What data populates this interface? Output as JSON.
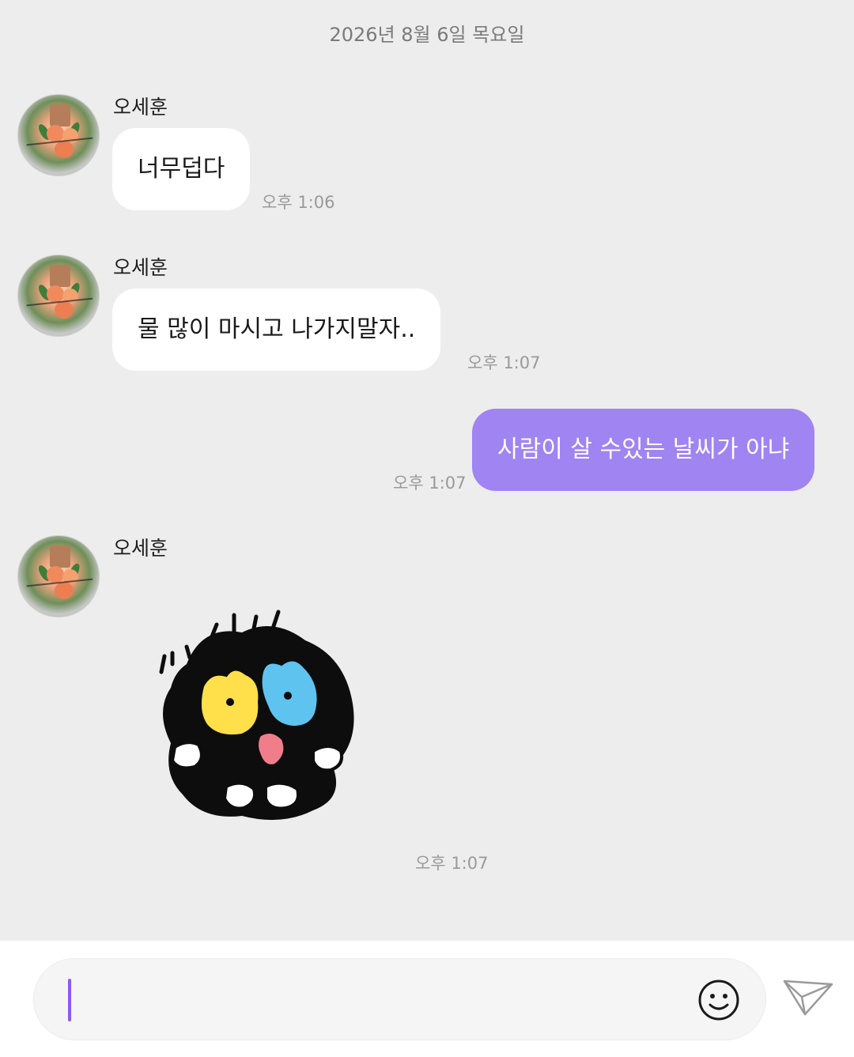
{
  "date_divider": "2026년 8월 6일 목요일",
  "messages": [
    {
      "sender": "오세훈",
      "text": "너무덥다",
      "time": "오후 1:06"
    },
    {
      "sender": "오세훈",
      "text": "물 많이 마시고 나가지말자..",
      "time": "오후 1:07"
    },
    {
      "sender": "me",
      "text": "사람이 살 수있는 날씨가 아냐",
      "time": "오후 1:07"
    },
    {
      "sender": "오세훈",
      "sticker": "screaming-blob-sticker",
      "time": "오후 1:07"
    }
  ],
  "input": {
    "value": "",
    "placeholder": ""
  },
  "icons": {
    "emoji": "smiley-icon",
    "send": "paper-plane-icon",
    "avatar": "bouquet-photo"
  },
  "colors": {
    "background": "#ededed",
    "my_bubble": "#a084f2",
    "other_bubble": "#ffffff",
    "caret": "#8b5cf6"
  }
}
